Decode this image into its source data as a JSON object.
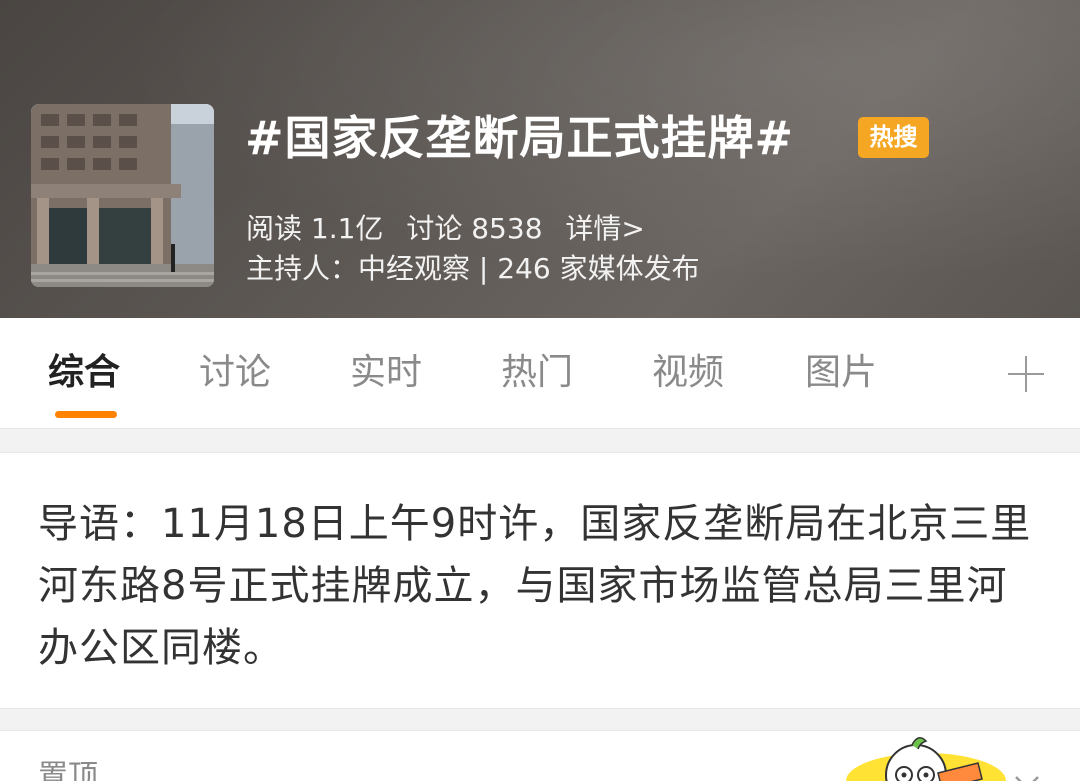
{
  "topic": {
    "title": "#国家反垄断局正式挂牌#",
    "badge": "热搜",
    "stats": {
      "reads": "阅读 1.1亿",
      "discussions": "讨论 8538",
      "details_link": "详情>"
    },
    "host_line": "主持人：中经观察 | 246 家媒体发布"
  },
  "tabs": [
    {
      "label": "综合",
      "active": true
    },
    {
      "label": "讨论",
      "active": false
    },
    {
      "label": "实时",
      "active": false
    },
    {
      "label": "热门",
      "active": false
    },
    {
      "label": "视频",
      "active": false
    },
    {
      "label": "图片",
      "active": false
    }
  ],
  "icons": {
    "add_tab": "plus-icon",
    "collapse": "chevron-down-icon"
  },
  "guide": {
    "text": "导语：11月18日上午9时许，国家反垄断局在北京三里河东路8号正式挂牌成立，与国家市场监管总局三里河办公区同楼。"
  },
  "pinned": {
    "label": "置顶"
  },
  "colors": {
    "accent": "#ff8200",
    "badge": "#f5a623",
    "text_dark": "#222222",
    "text_muted": "#8a8a8a"
  }
}
